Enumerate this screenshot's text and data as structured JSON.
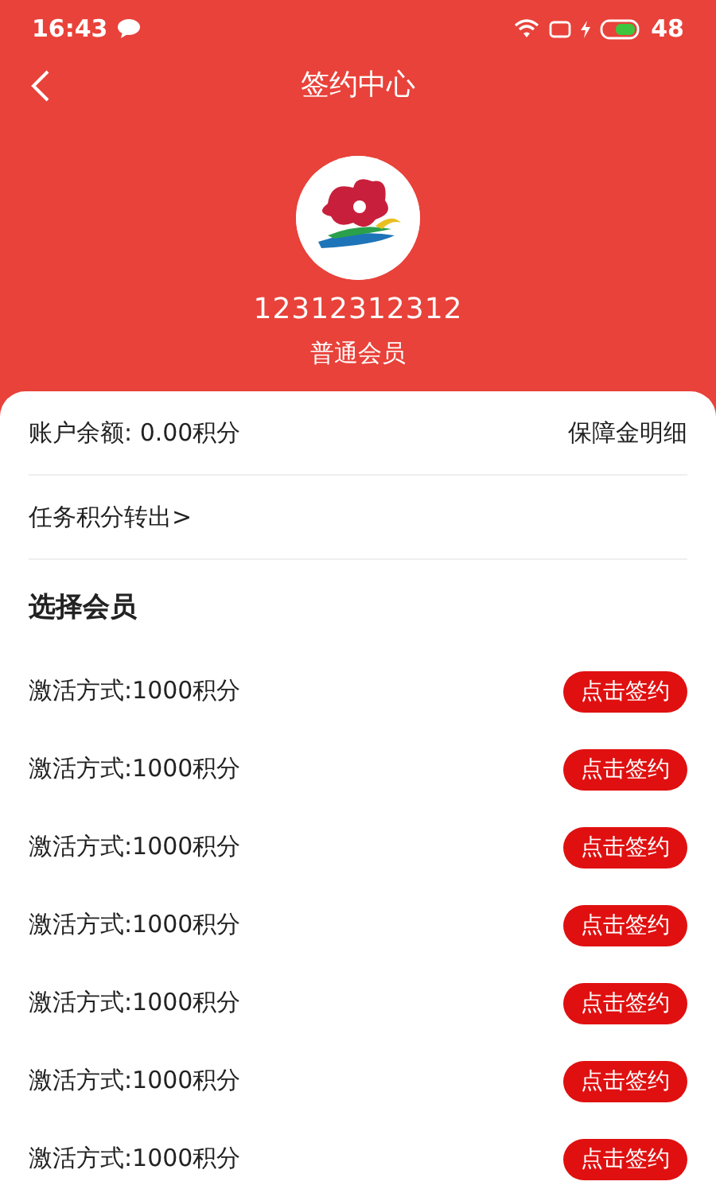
{
  "status_bar": {
    "time": "16:43",
    "battery": "48"
  },
  "header": {
    "title": "签约中心"
  },
  "profile": {
    "account": "12312312312",
    "member_level": "普通会员"
  },
  "balance": {
    "label": "账户余额: 0.00积分",
    "link": "保障金明细"
  },
  "transfer": {
    "label": "任务积分转出>"
  },
  "section_title": "选择会员",
  "plans": [
    {
      "label": "激活方式:1000积分",
      "button": "点击签约"
    },
    {
      "label": "激活方式:1000积分",
      "button": "点击签约"
    },
    {
      "label": "激活方式:1000积分",
      "button": "点击签约"
    },
    {
      "label": "激活方式:1000积分",
      "button": "点击签约"
    },
    {
      "label": "激活方式:1000积分",
      "button": "点击签约"
    },
    {
      "label": "激活方式:1000积分",
      "button": "点击签约"
    },
    {
      "label": "激活方式:1000积分",
      "button": "点击签约"
    }
  ]
}
